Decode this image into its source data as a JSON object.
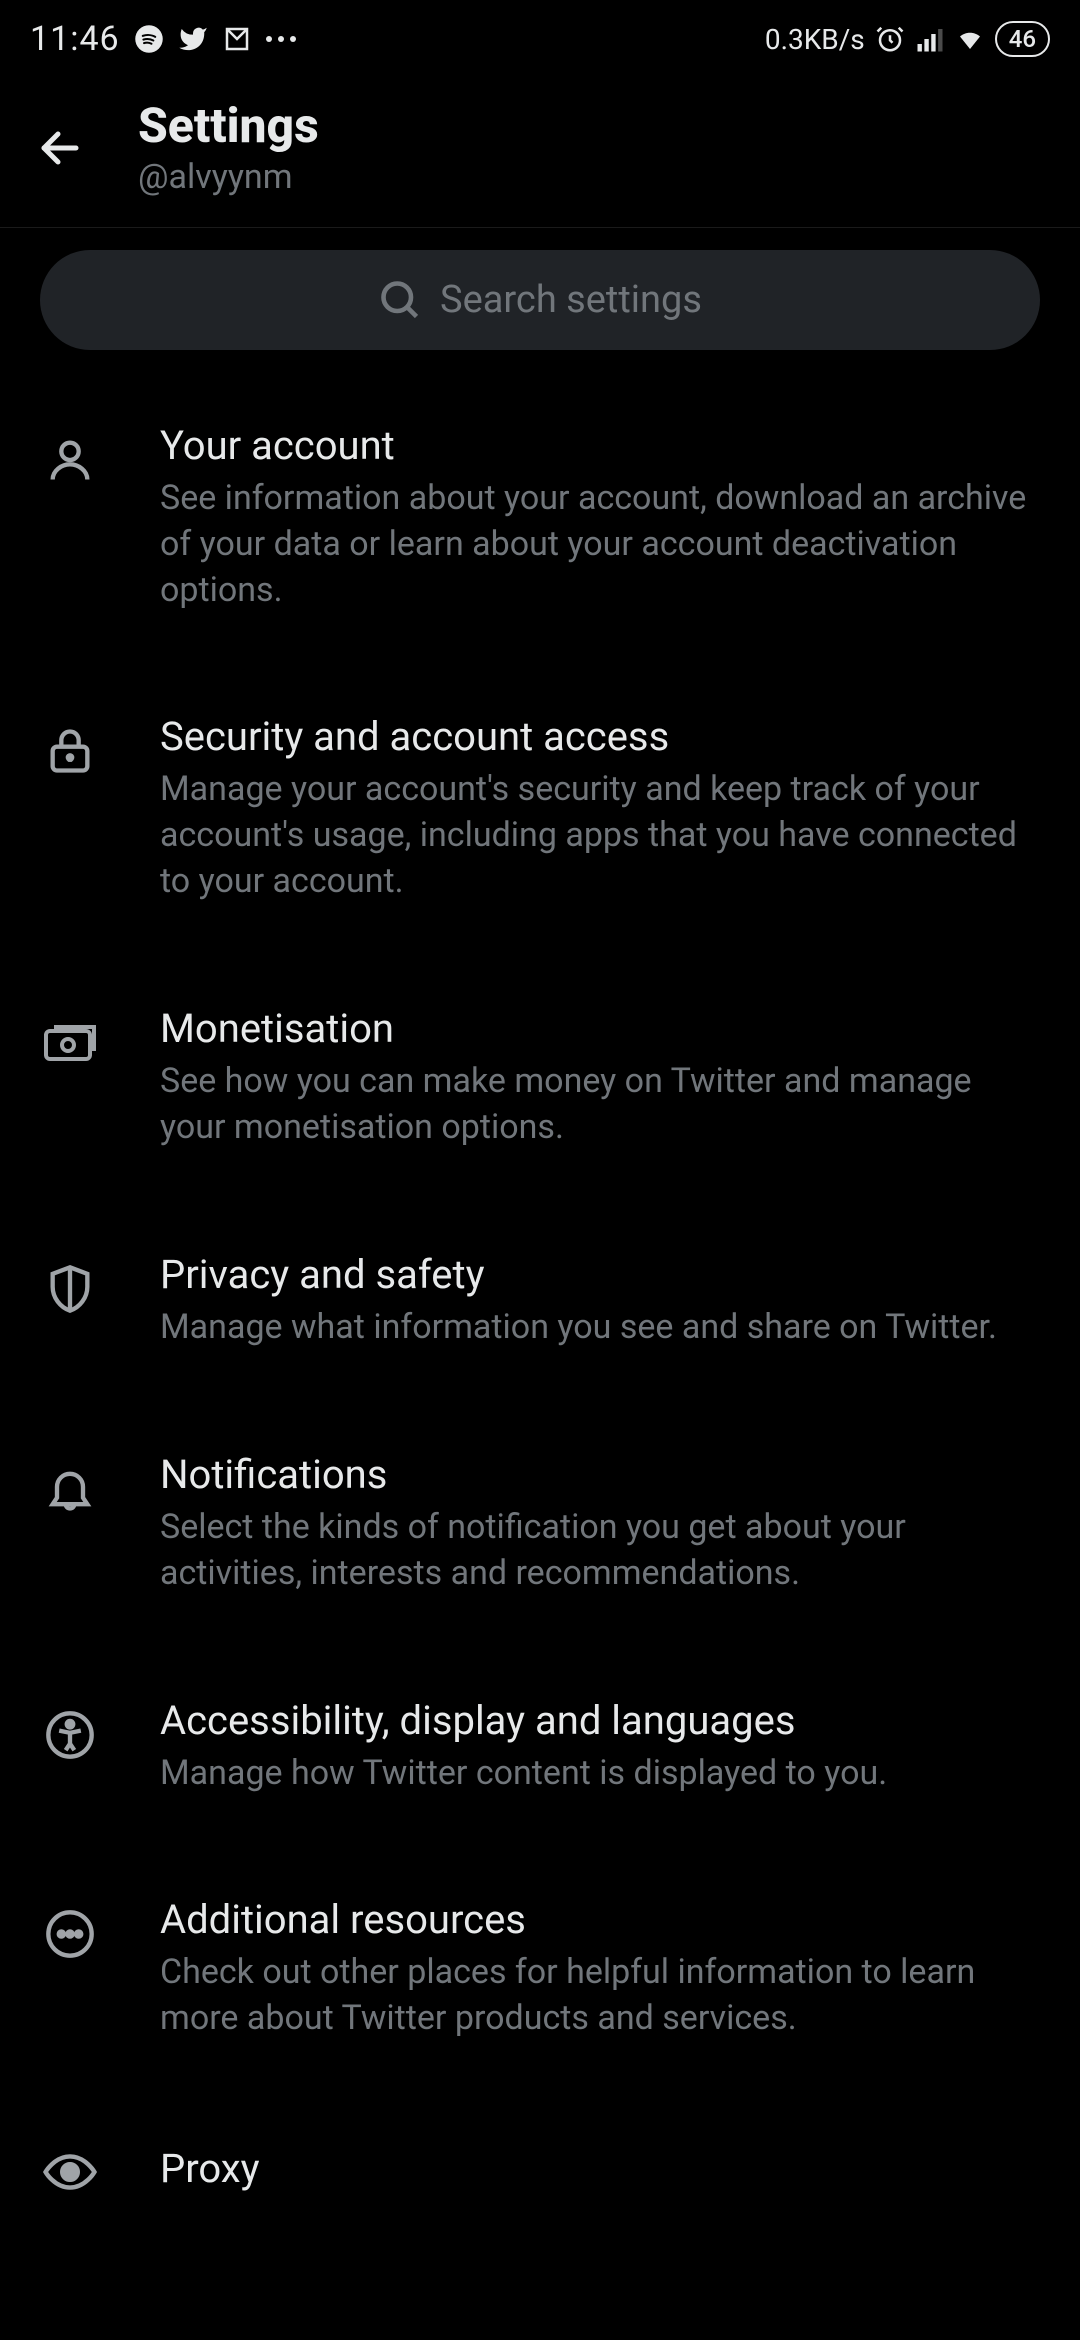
{
  "status_bar": {
    "time": "11:46",
    "data_rate": "0.3KB/s",
    "battery": "46"
  },
  "header": {
    "title": "Settings",
    "subtitle": "@alvyynm"
  },
  "search": {
    "placeholder": "Search settings"
  },
  "items": [
    {
      "icon": "person-icon",
      "title": "Your account",
      "desc": "See information about your account, download an archive of your data or learn about your account deactivation options."
    },
    {
      "icon": "lock-icon",
      "title": "Security and account access",
      "desc": "Manage your account's security and keep track of your account's usage, including apps that you have connected to your account."
    },
    {
      "icon": "money-icon",
      "title": "Monetisation",
      "desc": "See how you can make money on Twitter and manage your monetisation options."
    },
    {
      "icon": "shield-icon",
      "title": "Privacy and safety",
      "desc": "Manage what information you see and share on Twitter."
    },
    {
      "icon": "bell-icon",
      "title": "Notifications",
      "desc": "Select the kinds of notification you get about your activities, interests and recommendations."
    },
    {
      "icon": "accessibility-icon",
      "title": "Accessibility, display and languages",
      "desc": "Manage how Twitter content is displayed to you."
    },
    {
      "icon": "more-circle-icon",
      "title": "Additional resources",
      "desc": "Check out other places for helpful information to learn more about Twitter products and services."
    },
    {
      "icon": "eye-icon",
      "title": "Proxy",
      "desc": ""
    }
  ]
}
